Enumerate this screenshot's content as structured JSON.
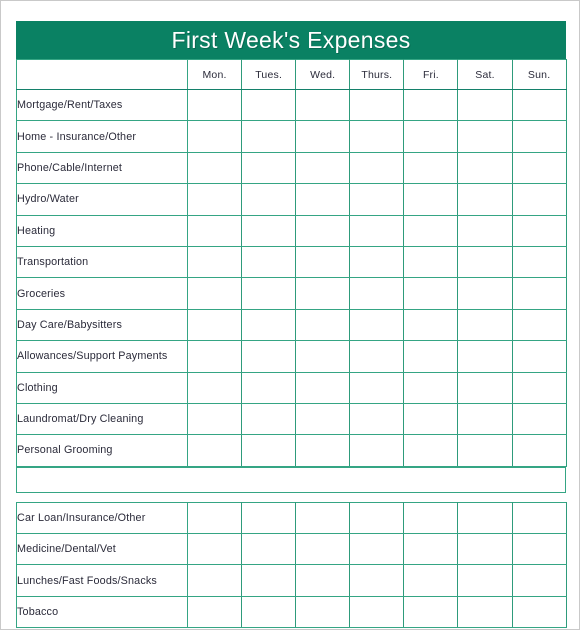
{
  "page": {
    "title": "First Week's Expenses",
    "accent_color": "#0a8163",
    "grid_color": "#35a584",
    "text_color": "#2b2b3a",
    "border_color": "#c9c9c9"
  },
  "banner": {
    "title": "First Week's Expenses"
  },
  "table": {
    "corner_header": "",
    "day_headers": [
      "Mon.",
      "Tues.",
      "Wed.",
      "Thurs.",
      "Fri.",
      "Sat.",
      "Sun."
    ],
    "section_one": [
      "Mortgage/Rent/Taxes",
      "Home - Insurance/Other",
      "Phone/Cable/Internet",
      "Hydro/Water",
      "Heating",
      "Transportation",
      "Groceries",
      "Day Care/Babysitters",
      "Allowances/Support Payments",
      "Clothing",
      "Laundromat/Dry Cleaning",
      "Personal Grooming"
    ],
    "spacer_label": "",
    "section_two": [
      "Car Loan/Insurance/Other",
      "Medicine/Dental/Vet",
      "Lunches/Fast Foods/Snacks",
      "Tobacco"
    ]
  }
}
